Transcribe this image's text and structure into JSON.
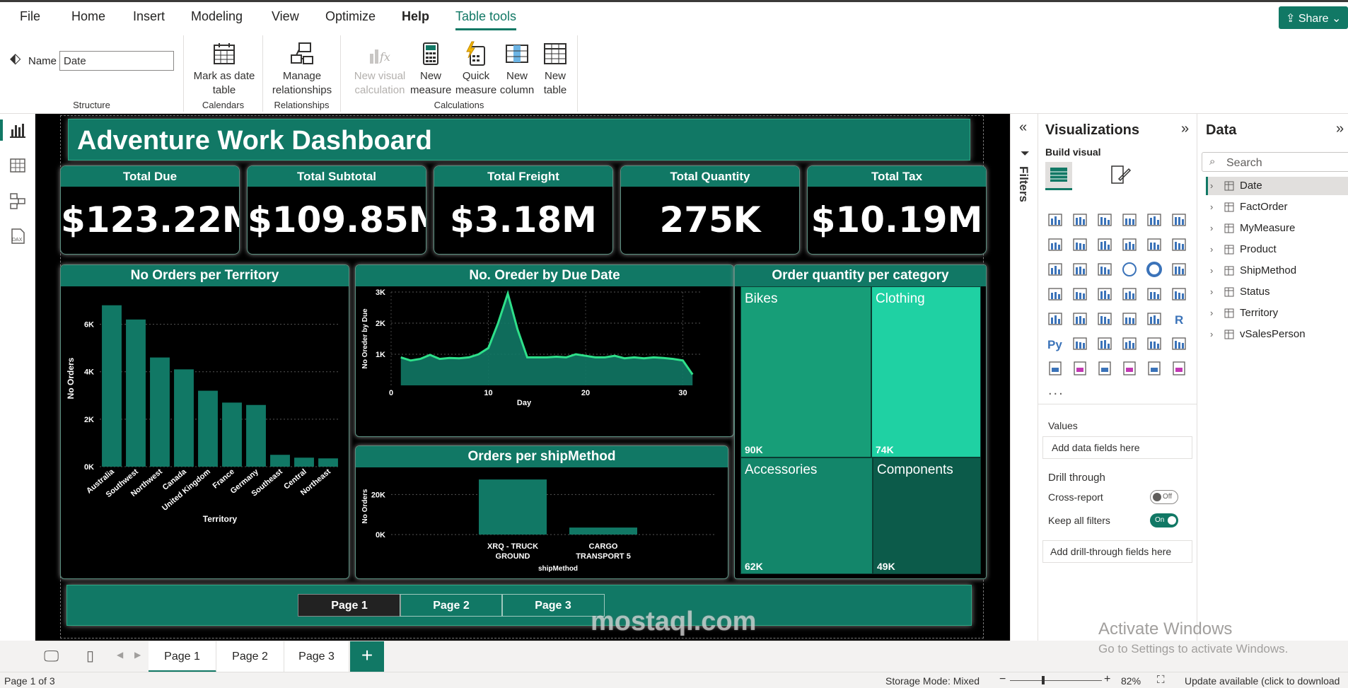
{
  "ribbon": {
    "tabs": [
      "File",
      "Home",
      "Insert",
      "Modeling",
      "View",
      "Optimize",
      "Help",
      "Table tools"
    ],
    "share_label": "Share",
    "name_label": "Name",
    "name_value": "Date",
    "groups": {
      "structure": "Structure",
      "calendars": "Calendars",
      "relationships": "Relationships",
      "calculations": "Calculations"
    },
    "buttons": {
      "mark_date_1": "Mark as date",
      "mark_date_2": "table",
      "manage_rel_1": "Manage",
      "manage_rel_2": "relationships",
      "new_visual_calc_1": "New visual",
      "new_visual_calc_2": "calculation",
      "new_measure_1": "New",
      "new_measure_2": "measure",
      "quick_measure_1": "Quick",
      "quick_measure_2": "measure",
      "new_column_1": "New",
      "new_column_2": "column",
      "new_table_1": "New",
      "new_table_2": "table"
    }
  },
  "report": {
    "title": "Adventure Work Dashboard",
    "kpis": [
      {
        "label": "Total Due",
        "value": "$123.22M"
      },
      {
        "label": "Total Subtotal",
        "value": "$109.85M"
      },
      {
        "label": "Total Freight",
        "value": "$3.18M"
      },
      {
        "label": "Total Quantity",
        "value": "275K"
      },
      {
        "label": "Total Tax",
        "value": "$10.19M"
      }
    ],
    "territory_title": "No Orders per Territory",
    "due_date_title": "No. Oreder by Due Date",
    "ship_title": "Orders per shipMethod",
    "category_title": "Order quantity per category",
    "page_buttons": [
      "Page 1",
      "Page 2",
      "Page 3"
    ]
  },
  "chart_data": [
    {
      "type": "bar",
      "title": "No Orders per Territory",
      "xlabel": "Territory",
      "ylabel": "No Orders",
      "categories": [
        "Australia",
        "Southwest",
        "Northwest",
        "Canada",
        "United Kingdom",
        "France",
        "Germany",
        "Southeast",
        "Central",
        "Northeast"
      ],
      "values": [
        6800,
        6200,
        4600,
        4100,
        3200,
        2700,
        2600,
        500,
        380,
        350
      ],
      "ylim": [
        0,
        7000
      ],
      "yticks": [
        "0K",
        "2K",
        "4K",
        "6K"
      ],
      "color": "#117865",
      "grid": true
    },
    {
      "type": "area",
      "title": "No. Oreder by Due Date",
      "xlabel": "Day",
      "ylabel": "No Oreder by Due",
      "x": [
        1,
        2,
        3,
        4,
        5,
        6,
        7,
        8,
        9,
        10,
        11,
        12,
        13,
        14,
        15,
        16,
        17,
        18,
        19,
        20,
        21,
        22,
        23,
        24,
        25,
        26,
        27,
        28,
        29,
        30,
        31
      ],
      "values": [
        900,
        800,
        850,
        980,
        850,
        880,
        870,
        900,
        1000,
        1200,
        2000,
        2950,
        1800,
        900,
        900,
        900,
        920,
        900,
        1000,
        950,
        900,
        900,
        950,
        870,
        900,
        870,
        900,
        880,
        850,
        800,
        350
      ],
      "ylim": [
        0,
        3000
      ],
      "yticks": [
        "1K",
        "2K",
        "3K"
      ],
      "xticks": [
        "0",
        "10",
        "20",
        "30"
      ],
      "line_color": "#2ee08a",
      "fill_color": "#117865",
      "grid": true
    },
    {
      "type": "bar",
      "title": "Orders per shipMethod",
      "xlabel": "shipMethod",
      "ylabel": "No Orders",
      "categories": [
        "XRQ - TRUCK GROUND",
        "CARGO TRANSPORT 5"
      ],
      "values": [
        27500,
        3500
      ],
      "ylim": [
        0,
        30000
      ],
      "yticks": [
        "0K",
        "20K"
      ],
      "color": "#117865"
    },
    {
      "type": "treemap",
      "title": "Order quantity per category",
      "categories": [
        "Bikes",
        "Clothing",
        "Accessories",
        "Components"
      ],
      "values": [
        90000,
        74000,
        62000,
        49000
      ],
      "labels": [
        "90K",
        "74K",
        "62K",
        "49K"
      ],
      "colors": [
        "#179e78",
        "#1fd1a3",
        "#13866a",
        "#0c5b4a"
      ]
    }
  ],
  "filters": {
    "label": "Filters"
  },
  "visualizations": {
    "title": "Visualizations",
    "build_visual": "Build visual",
    "values_label": "Values",
    "values_placeholder": "Add data fields here",
    "drill_through": "Drill through",
    "cross_report": "Cross-report",
    "cross_report_state": "Off",
    "keep_filters": "Keep all filters",
    "keep_filters_state": "On",
    "drill_placeholder": "Add drill-through fields here",
    "more": "..."
  },
  "data_pane": {
    "title": "Data",
    "search_placeholder": "Search",
    "tables": [
      "Date",
      "FactOrder",
      "MyMeasure",
      "Product",
      "ShipMethod",
      "Status",
      "Territory",
      "vSalesPerson"
    ]
  },
  "page_tabs": [
    "Page 1",
    "Page 2",
    "Page 3"
  ],
  "add_page": "+",
  "status": {
    "page_info": "Page 1 of 3",
    "storage_mode": "Storage Mode: Mixed",
    "zoom": "82%",
    "update": "Update available (click to download"
  },
  "watermark": {
    "activate_title": "Activate Windows",
    "activate_sub": "Go to Settings to activate Windows.",
    "site": "mostaql.com"
  },
  "colors": {
    "accent": "#117865",
    "accent_light": "#1fd1a3",
    "report_bg": "#000000"
  }
}
